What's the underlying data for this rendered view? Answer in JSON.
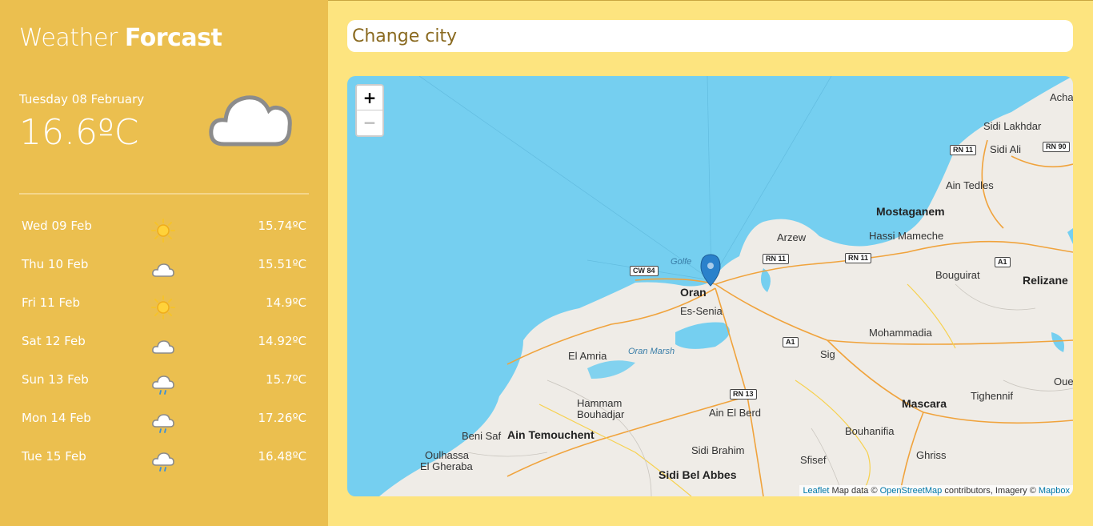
{
  "sidebar": {
    "title_light": "Weather",
    "title_bold": "Forcast",
    "today": {
      "date": "Tuesday 08 February",
      "temp": "16.6ºC",
      "icon": "cloud-icon"
    },
    "forecast": [
      {
        "day": "Wed 09 Feb",
        "icon": "sun-icon",
        "temp": "15.74ºC"
      },
      {
        "day": "Thu 10 Feb",
        "icon": "cloud-icon",
        "temp": "15.51ºC"
      },
      {
        "day": "Fri 11 Feb",
        "icon": "sun-icon",
        "temp": "14.9ºC"
      },
      {
        "day": "Sat 12 Feb",
        "icon": "cloud-icon",
        "temp": "14.92ºC"
      },
      {
        "day": "Sun 13 Feb",
        "icon": "rain-cloud-icon",
        "temp": "15.7ºC"
      },
      {
        "day": "Mon 14 Feb",
        "icon": "rain-cloud-icon",
        "temp": "17.26ºC"
      },
      {
        "day": "Tue 15 Feb",
        "icon": "rain-cloud-icon",
        "temp": "16.48ºC"
      }
    ]
  },
  "search": {
    "placeholder": "Change city"
  },
  "map": {
    "zoom_in": "+",
    "zoom_out": "−",
    "labels": {
      "achac": "Achac",
      "sidi_lakhdar": "Sidi Lakhdar",
      "sidi_ali": "Sidi Ali",
      "ain_tedles": "Ain Tedles",
      "mostaganem": "Mostaganem",
      "hassi_mameche": "Hassi Mameche",
      "arzew": "Arzew",
      "golfe": "Golfe",
      "oran": "Oran",
      "es_senia": "Es-Senia",
      "bouguirat": "Bouguirat",
      "relizane": "Relizane",
      "mohammadia": "Mohammadia",
      "el_amria": "El Amria",
      "oran_marsh": "Oran Marsh",
      "sig": "Sig",
      "hammam_bouhadjar_1": "Hammam",
      "hammam_bouhadjar_2": "Bouhadjar",
      "mascara": "Mascara",
      "tighennif": "Tighennif",
      "oued": "Oued",
      "ain_el_berd": "Ain El Berd",
      "beni_saf": "Beni Saf",
      "ain_temouchent": "Ain Temouchent",
      "bouhanifia": "Bouhanifia",
      "oulhassa": "Oulhassa",
      "el_gheraba": "El Gheraba",
      "sidi_brahim": "Sidi Brahim",
      "sfisef": "Sfisef",
      "ghriss": "Ghriss",
      "sidi_bel_abbes": "Sidi Bel Abbes"
    },
    "roads": {
      "rn11_a": "RN 11",
      "rn90": "RN 90",
      "cw84": "CW 84",
      "rn11_b": "RN 11",
      "rn11_c": "RN 11",
      "a1_a": "A1",
      "a1_b": "A1",
      "rn13": "RN 13"
    },
    "attribution": {
      "leaflet": "Leaflet",
      "text1": " Map data © ",
      "osm": "OpenStreetMap",
      "text2": " contributors, Imagery © ",
      "mapbox": "Mapbox"
    }
  }
}
